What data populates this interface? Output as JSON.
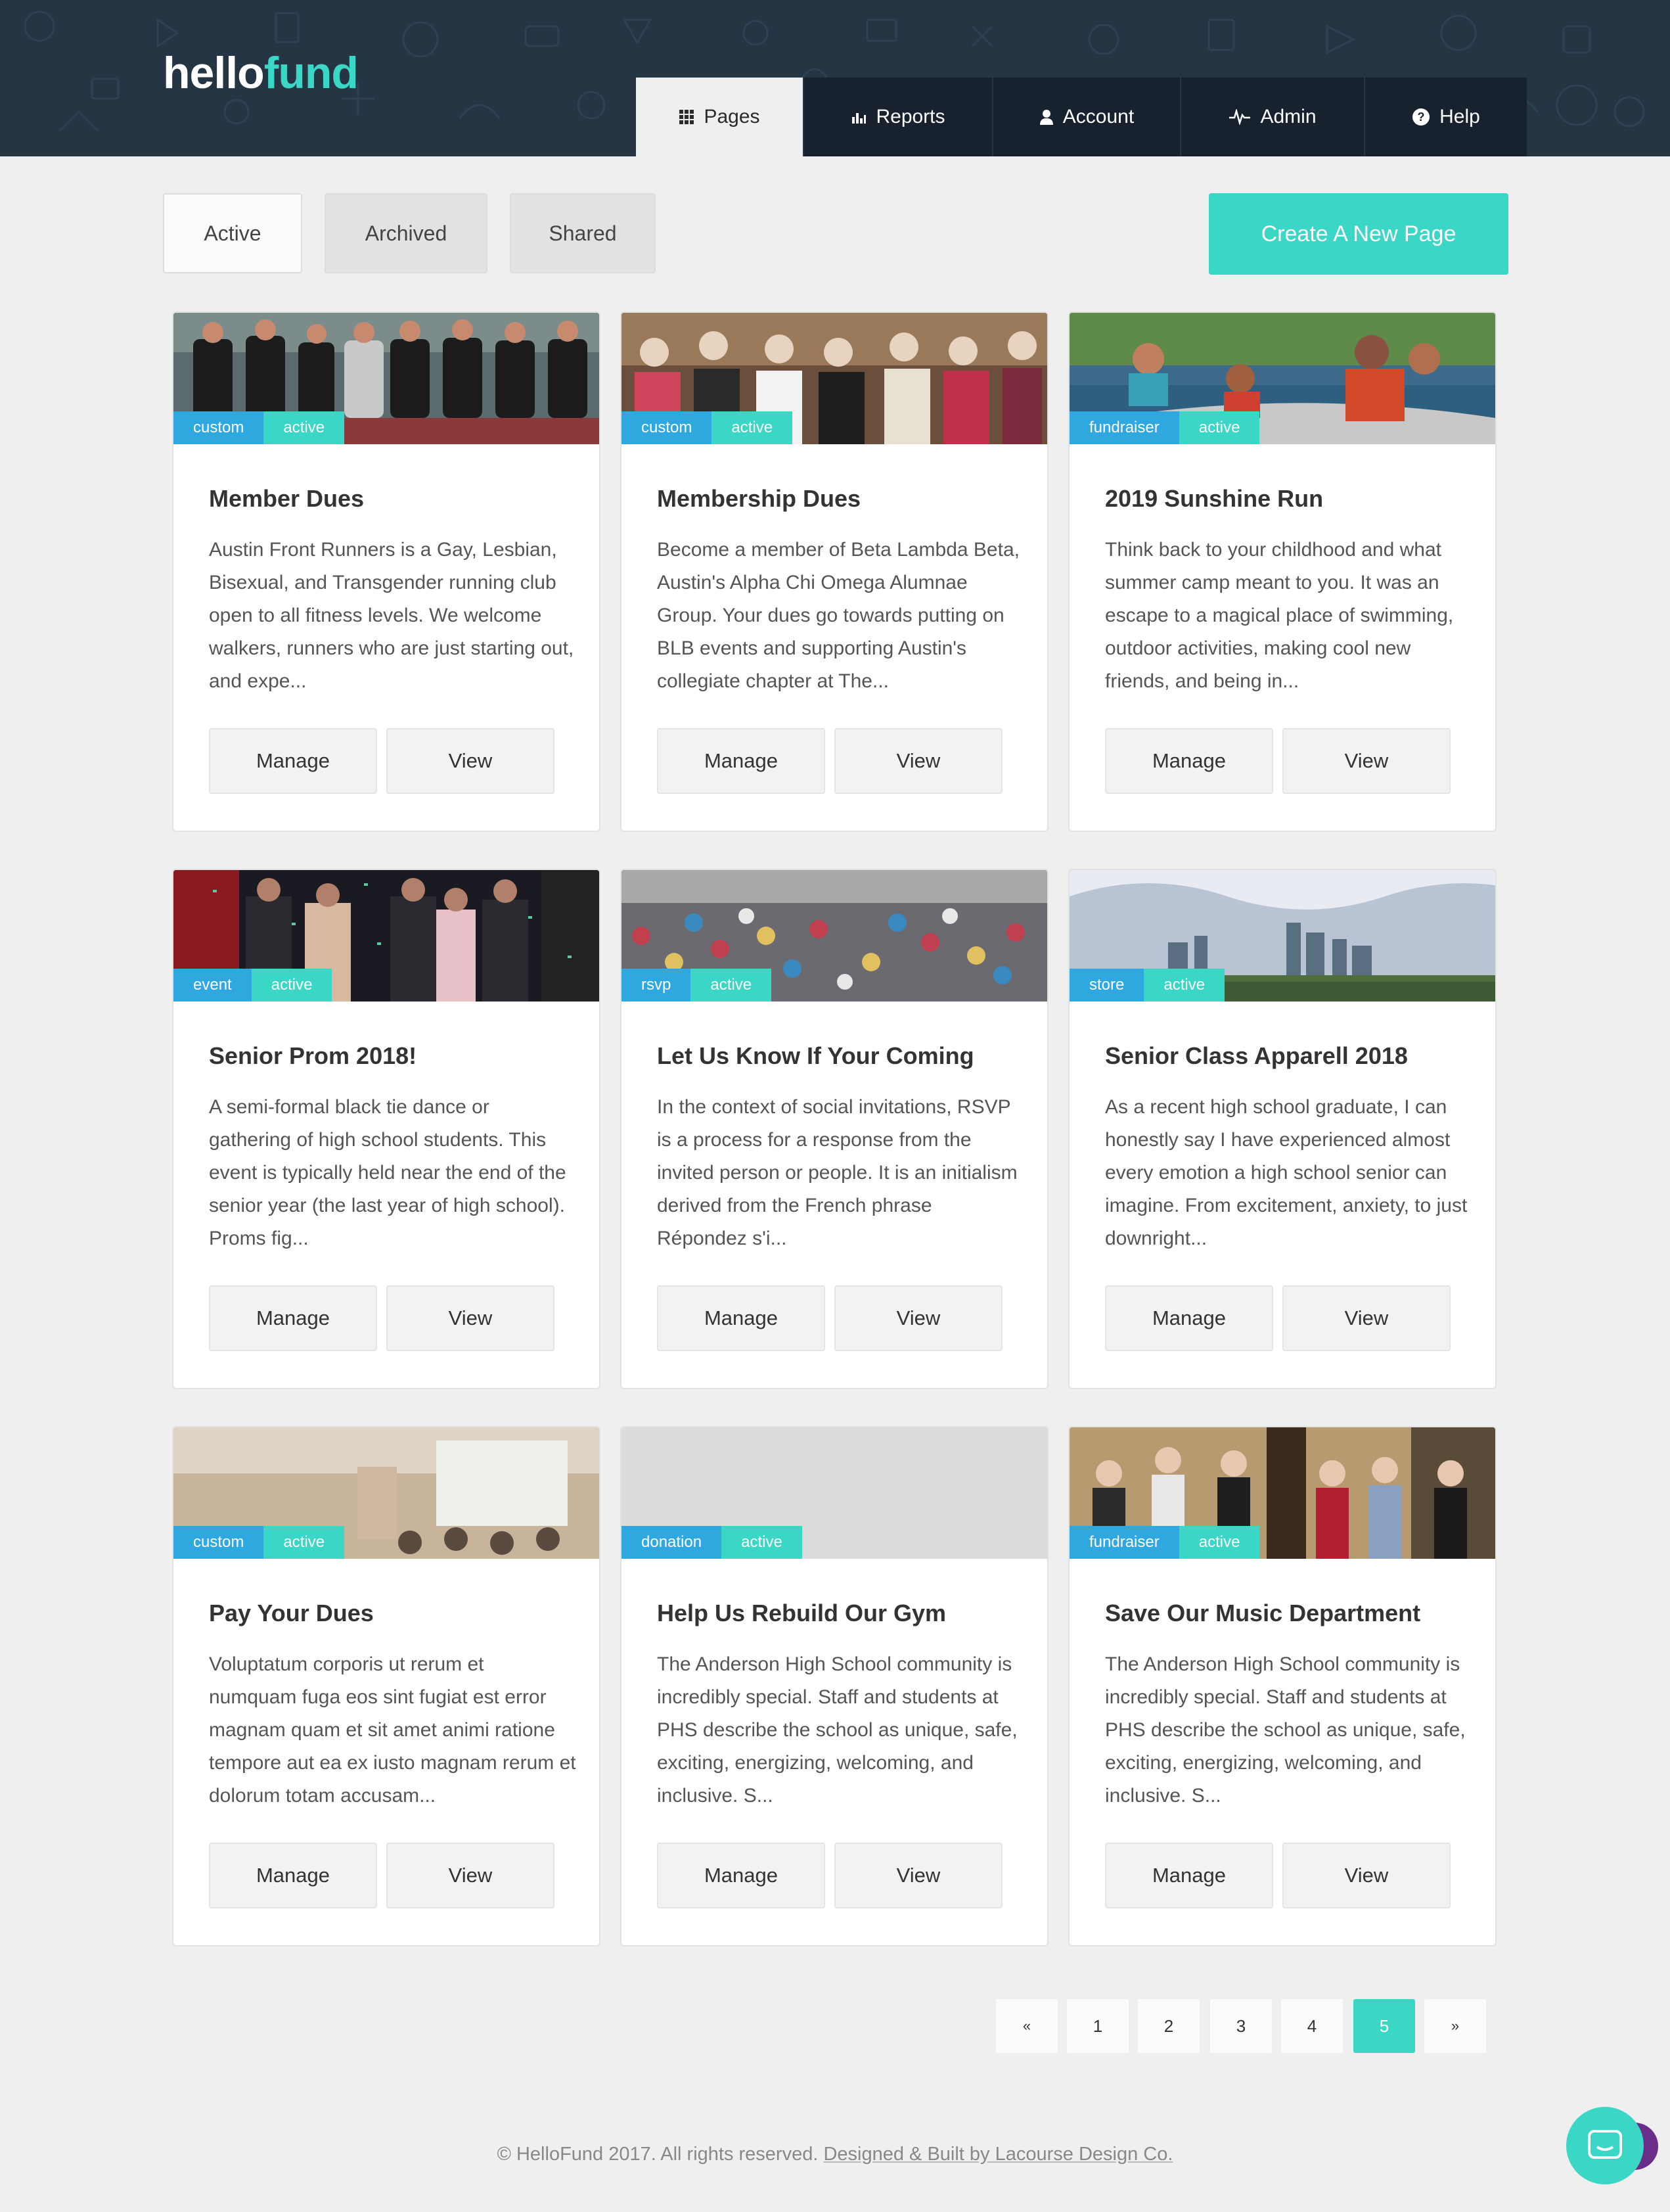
{
  "brand": {
    "part1": "hello",
    "part2": "fund"
  },
  "nav": [
    {
      "label": "Pages",
      "icon": "grid-icon",
      "active": true
    },
    {
      "label": "Reports",
      "icon": "bar-chart-icon",
      "active": false
    },
    {
      "label": "Account",
      "icon": "user-icon",
      "active": false
    },
    {
      "label": "Admin",
      "icon": "pulse-icon",
      "active": false
    },
    {
      "label": "Help",
      "icon": "question-circle-icon",
      "active": false
    }
  ],
  "filters": {
    "active": "Active",
    "archived": "Archived",
    "shared": "Shared"
  },
  "create_label": "Create A New Page",
  "buttons": {
    "manage": "Manage",
    "view": "View"
  },
  "cards": [
    {
      "type": "custom",
      "status": "active",
      "title": "Member Dues",
      "description": "Austin Front Runners is a Gay, Lesbian, Bisexual, and Transgender running club open to all fitness levels. We welcome walkers, runners who are just starting out, and expe..."
    },
    {
      "type": "custom",
      "status": "active",
      "title": "Membership Dues",
      "description": "Become a member of Beta Lambda Beta, Austin's Alpha Chi Omega Alumnae Group. Your dues go towards putting on BLB events and supporting Austin's collegiate chapter at The..."
    },
    {
      "type": "fundraiser",
      "status": "active",
      "title": "2019 Sunshine Run",
      "description": "Think back to your childhood and what summer camp meant to you. It was an escape to a magical place of swimming, outdoor activities, making cool new friends, and being in..."
    },
    {
      "type": "event",
      "status": "active",
      "title": "Senior Prom 2018!",
      "description": "A semi-formal black tie dance or gathering of high school students. This event is typically held near the end of the senior year (the last year of high school). Proms fig..."
    },
    {
      "type": "rsvp",
      "status": "active",
      "title": "Let Us Know If Your Coming",
      "description": "In the context of social invitations, RSVP is a process for a response from the invited person or people. It is an initialism derived from the French phrase Répondez s'i..."
    },
    {
      "type": "store",
      "status": "active",
      "title": "Senior Class Apparell 2018",
      "description": "As a recent high school graduate, I can honestly say I have experienced almost every emotion a high school senior can imagine. From excitement, anxiety, to just downright..."
    },
    {
      "type": "custom",
      "status": "active",
      "title": "Pay Your Dues",
      "description": "Voluptatum corporis ut rerum et numquam fuga eos sint fugiat est error magnam quam et sit amet animi ratione tempore aut ea ex iusto magnam rerum et dolorum totam accusam..."
    },
    {
      "type": "donation",
      "status": "active",
      "title": "Help Us Rebuild Our Gym",
      "description": "The Anderson High School community is incredibly special. Staff and students at PHS describe the school as unique, safe, exciting, energizing, welcoming, and inclusive. S..."
    },
    {
      "type": "fundraiser",
      "status": "active",
      "title": "Save Our Music Department",
      "description": "The Anderson High School community is incredibly special. Staff and students at PHS describe the school as unique, safe, exciting, energizing, welcoming, and inclusive. S..."
    }
  ],
  "pagination": {
    "prev": "«",
    "pages": [
      "1",
      "2",
      "3",
      "4",
      "5"
    ],
    "current": "5",
    "next": "»"
  },
  "footer": {
    "copyright": "© HelloFund 2017. All rights reserved.",
    "credit": "Designed & Built by Lacourse Design Co."
  },
  "colors": {
    "accent": "#3ad6c6",
    "type_tag": "#2fa8e0",
    "header": "#263544"
  }
}
